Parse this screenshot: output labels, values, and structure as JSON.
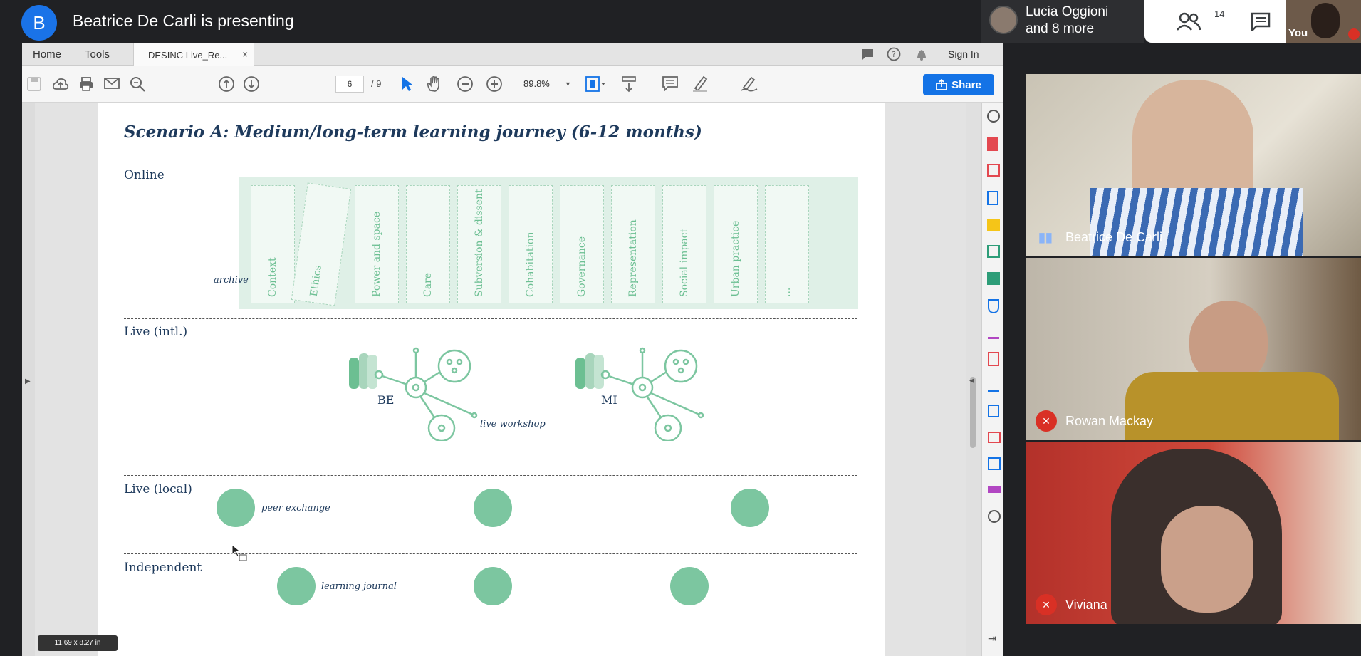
{
  "meet": {
    "presenter_initial": "B",
    "presenting_text": "Beatrice De Carli is presenting",
    "participants_line1": "Lucia Oggioni",
    "participants_line2": "and 8 more",
    "people_count": "14",
    "self_label": "You"
  },
  "acrobat": {
    "menu": {
      "home": "Home",
      "tools": "Tools",
      "sign_in": "Sign In"
    },
    "tab_title": "DESINC Live_Re...",
    "tab_close": "×",
    "page_current": "6",
    "page_total": "/ 9",
    "zoom": "89.8%",
    "share_label": "Share",
    "page_size": "11.69 x 8.27 in"
  },
  "pdf": {
    "title": "Scenario A: Medium/long-term learning journey (6-12 months)",
    "rows": {
      "online": "Online",
      "live_intl": "Live (intl.)",
      "live_local": "Live (local)",
      "independent": "Independent"
    },
    "archive_label": "archive",
    "cards": [
      "Context",
      "Ethics",
      "Power and space",
      "Care",
      "Subversion & dissent",
      "Cohabitation",
      "Governance",
      "Representation",
      "Social impact",
      "Urban practice",
      "..."
    ],
    "intl_groups": [
      "BE",
      "MI"
    ],
    "live_workshop_label": "live workshop",
    "peer_exchange_label": "peer exchange",
    "learning_journal_label": "learning journal"
  },
  "video_tiles": [
    {
      "name": "Beatrice De Carli",
      "speaking": true
    },
    {
      "name": "Rowan Mackay",
      "muted": true
    },
    {
      "name": "Viviana",
      "muted": true
    }
  ],
  "colors": {
    "accent_green": "#7cc6a0",
    "title_navy": "#1e3a5c",
    "share_blue": "#1473e6",
    "meet_blue": "#1a73e8"
  }
}
